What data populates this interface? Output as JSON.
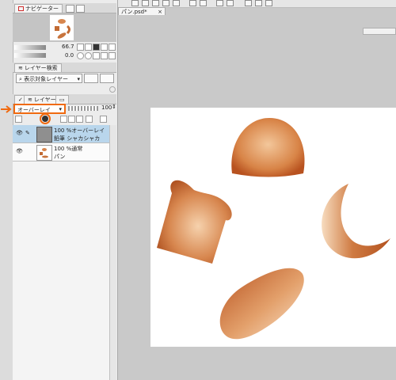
{
  "app": {
    "document_tab": "パン.psd*",
    "document_tab_close": "×"
  },
  "navigator": {
    "tab_label": "ナビゲーター",
    "zoom_value": "66.7",
    "rotate_value": "0.0"
  },
  "layer_search": {
    "tab_label": "レイヤー検索",
    "dropdown_value": "表示対象レイヤー"
  },
  "layer_panel": {
    "tab_label": "レイヤー",
    "blend_mode": "オーバーレイ",
    "opacity_value": "100",
    "layers": [
      {
        "line1": "100 %オーバーレイ",
        "line2": "鉛筆 シャカシャカ"
      },
      {
        "line1": "100 %通常",
        "line2": "パン"
      }
    ]
  },
  "colors": {
    "highlight": "#f06a10",
    "bread_dark": "#b8521f",
    "bread_light": "#f3c79b",
    "selected_layer": "#b9d6ec"
  }
}
